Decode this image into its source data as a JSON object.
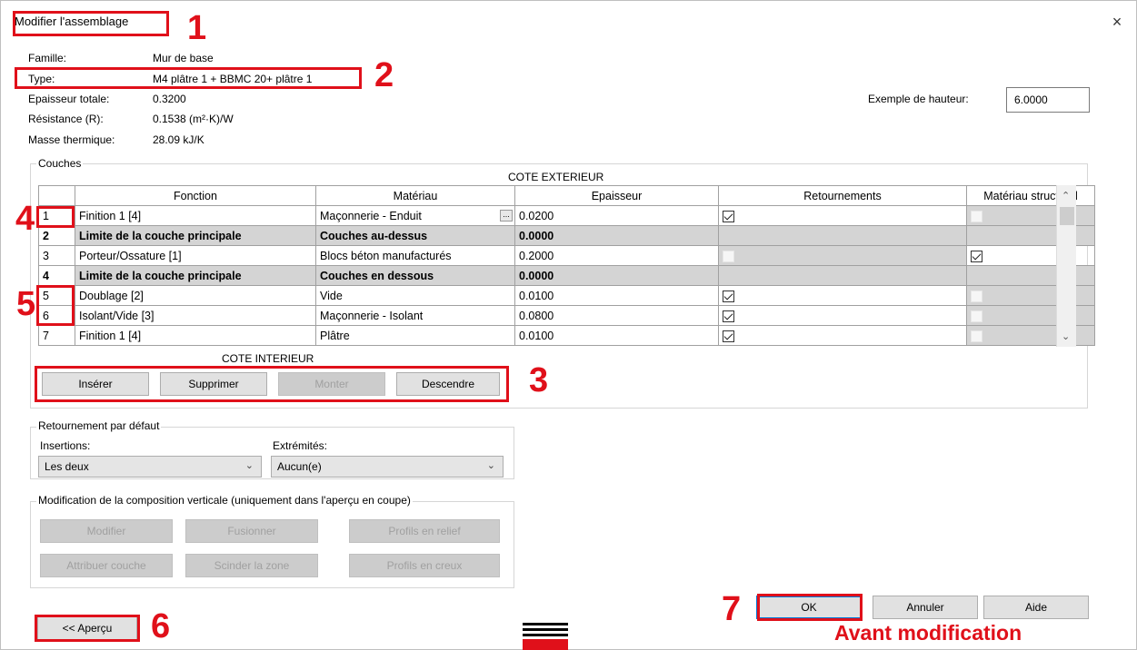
{
  "window": {
    "title": "Modifier l'assemblage",
    "close": "×"
  },
  "info": {
    "famille_label": "Famille:",
    "famille_value": "Mur de base",
    "type_label": "Type:",
    "type_value": "M4 plâtre 1 + BBMC 20+ plâtre 1",
    "epaisseur_label": "Epaisseur totale:",
    "epaisseur_value": "0.3200",
    "resistance_label": "Résistance (R):",
    "resistance_value": "0.1538 (m²·K)/W",
    "masse_label": "Masse thermique:",
    "masse_value": "28.09 kJ/K"
  },
  "height": {
    "label": "Exemple de hauteur:",
    "value": "6.0000"
  },
  "layers": {
    "group_label": "Couches",
    "exterior_label": "COTE EXTERIEUR",
    "interior_label": "COTE INTERIEUR",
    "headers": [
      "Fonction",
      "Matériau",
      "Epaisseur",
      "Retournements",
      "Matériau structurel"
    ],
    "rows": [
      {
        "num": "1",
        "fonction": "Finition 1 [4]",
        "materiau": "Maçonnerie - Enduit",
        "epaisseur": "0.0200",
        "retournement": true,
        "structurel": false
      },
      {
        "num": "2",
        "fonction": "Limite de la couche principale",
        "materiau": "Couches au-dessus",
        "epaisseur": "0.0000"
      },
      {
        "num": "3",
        "fonction": "Porteur/Ossature [1]",
        "materiau": "Blocs béton manufacturés",
        "epaisseur": "0.2000",
        "retournement": false,
        "structurel": true
      },
      {
        "num": "4",
        "fonction": "Limite de la couche principale",
        "materiau": "Couches en dessous",
        "epaisseur": "0.0000"
      },
      {
        "num": "5",
        "fonction": "Doublage [2]",
        "materiau": "Vide",
        "epaisseur": "0.0100",
        "retournement": true,
        "structurel": false
      },
      {
        "num": "6",
        "fonction": "Isolant/Vide [3]",
        "materiau": "Maçonnerie - Isolant",
        "epaisseur": "0.0800",
        "retournement": true,
        "structurel": false
      },
      {
        "num": "7",
        "fonction": "Finition 1 [4]",
        "materiau": "Plâtre",
        "epaisseur": "0.0100",
        "retournement": true,
        "structurel": false
      }
    ],
    "browse_glyph": "..."
  },
  "layer_buttons": {
    "inserer": "Insérer",
    "supprimer": "Supprimer",
    "monter": "Monter",
    "descendre": "Descendre"
  },
  "wrap_defaults": {
    "group_label": "Retournement par défaut",
    "insertions_label": "Insertions:",
    "insertions_value": "Les deux",
    "extremites_label": "Extrémités:",
    "extremites_value": "Aucun(e)"
  },
  "vertical": {
    "group_label": "Modification de la composition verticale (uniquement dans l'aperçu en coupe)",
    "modifier": "Modifier",
    "fusionner": "Fusionner",
    "relief": "Profils en relief",
    "attribuer": "Attribuer couche",
    "scinder": "Scinder la zone",
    "creux": "Profils en creux"
  },
  "footer": {
    "apercu": "<< Aperçu",
    "ok": "OK",
    "annuler": "Annuler",
    "aide": "Aide"
  },
  "annotations": {
    "m1": "1",
    "m2": "2",
    "m3": "3",
    "m4": "4",
    "m5": "5",
    "m6": "6",
    "m7": "7",
    "avant": "Avant modification"
  },
  "colors": {
    "annotation_red": "#e0101a",
    "row_grey": "#d4d4d4",
    "focus_blue": "#0078d7"
  }
}
